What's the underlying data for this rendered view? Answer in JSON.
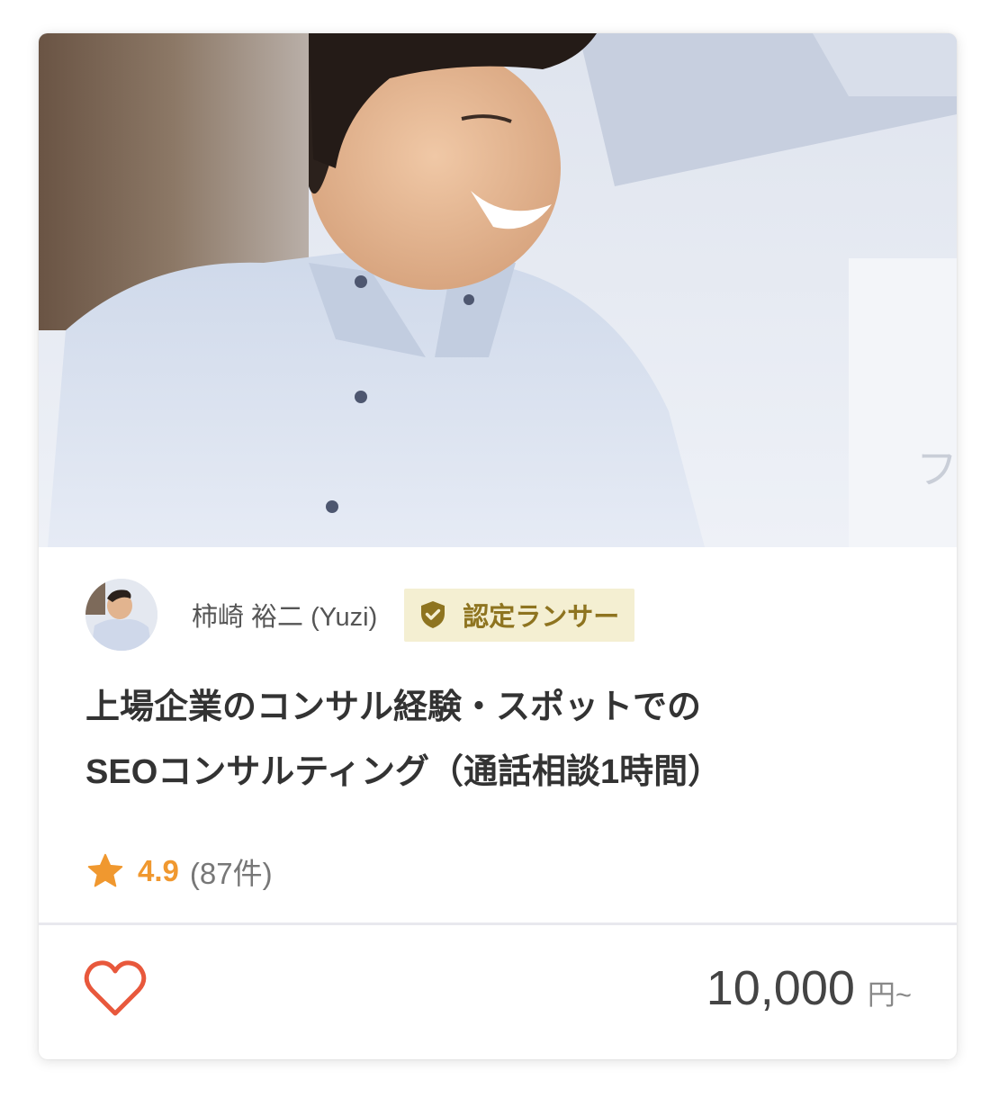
{
  "service_card": {
    "seller": {
      "name": "柿崎 裕二 (Yuzi)",
      "badge_label": "認定ランサー"
    },
    "title_line1": "上場企業のコンサル経験・スポットでの",
    "title_line2": "SEOコンサルティング（通話相談1時間）",
    "rating": {
      "score": "4.9",
      "count": "(87件)"
    },
    "price": {
      "value": "10,000",
      "unit": "円~"
    }
  },
  "icons": {
    "badge": "verified-shield-check-icon",
    "rating": "star-icon",
    "favorite": "heart-outline-icon"
  },
  "colors": {
    "badge_background": "#f4efd2",
    "badge_text": "#8e7420",
    "rating_star": "#f0982f",
    "favorite_heart": "#e8583c",
    "title_text": "#333333"
  }
}
